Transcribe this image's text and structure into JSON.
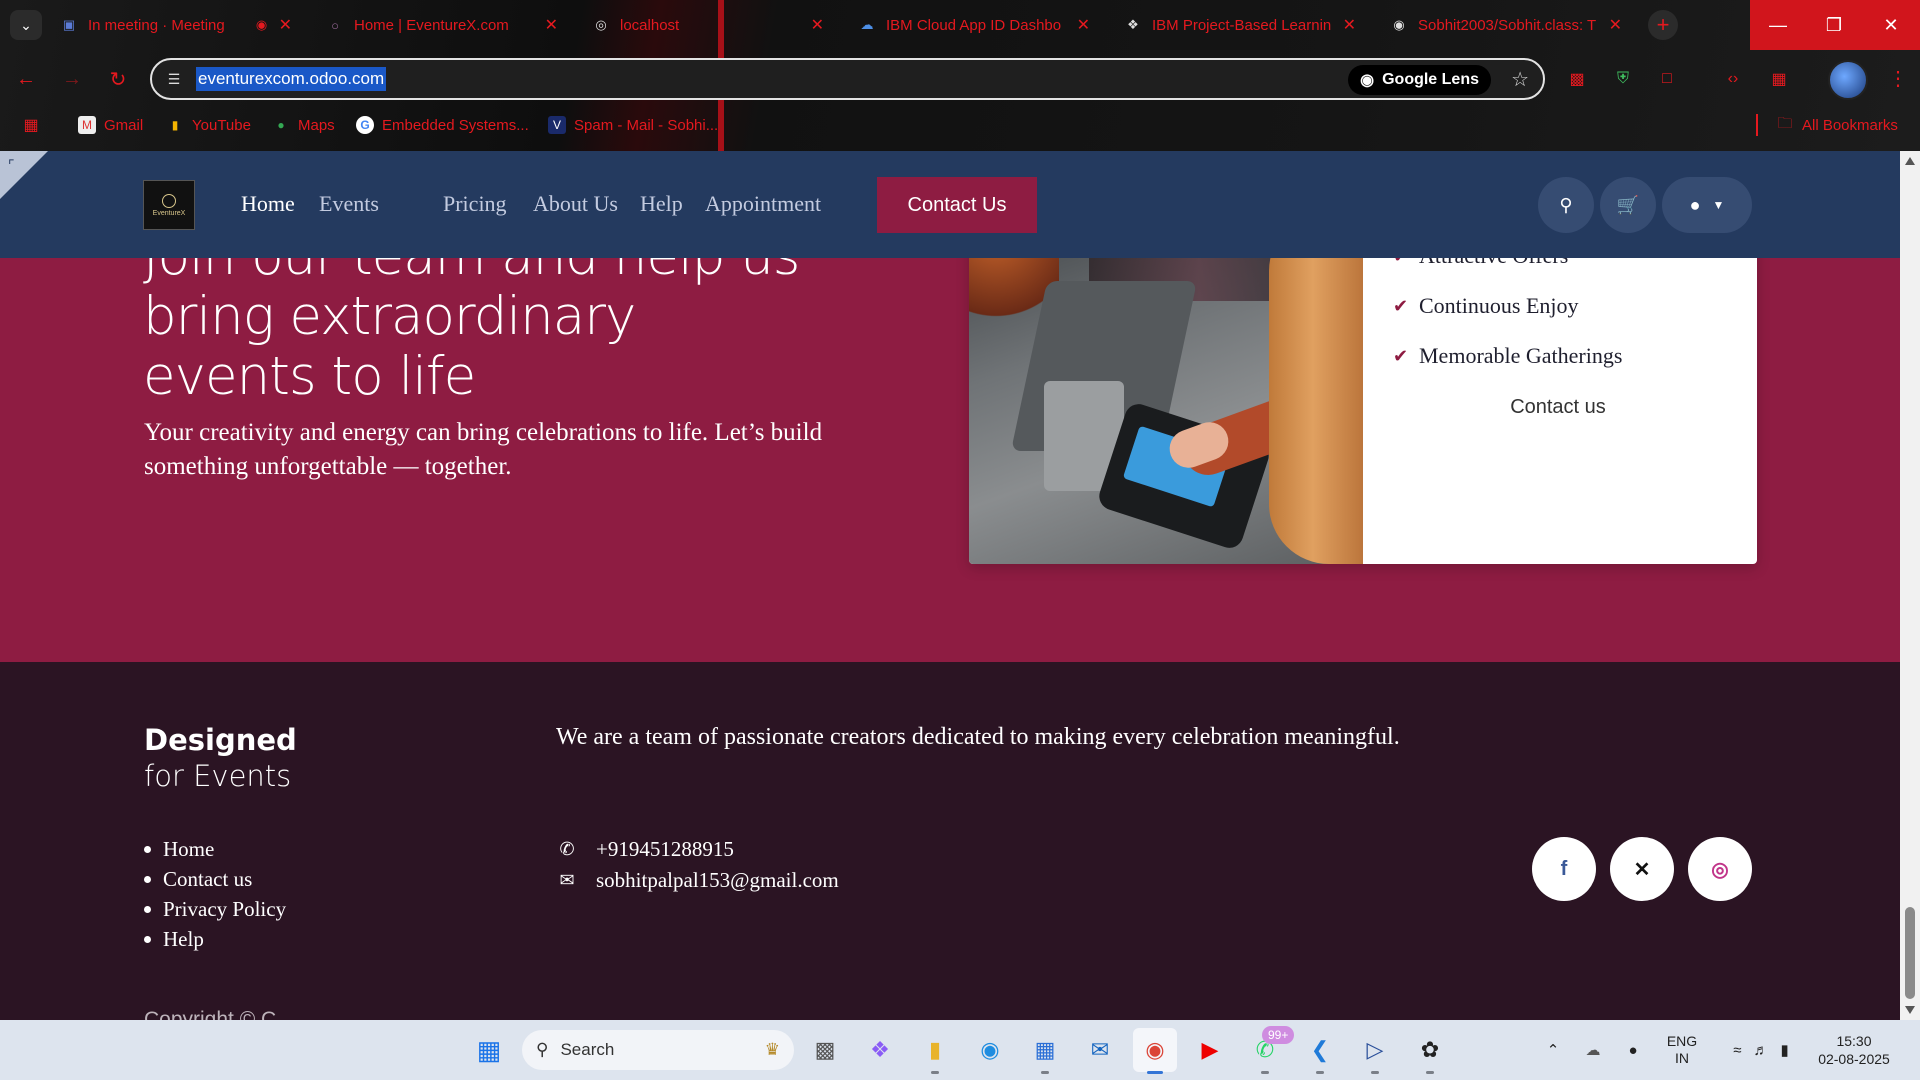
{
  "browser": {
    "tabs": [
      {
        "title": "In meeting · Meeting",
        "icon": "teams-icon",
        "glyph": "▣",
        "active": false
      },
      {
        "title": "Home | EventureX.com",
        "icon": "odoo-icon",
        "glyph": "○",
        "active": false
      },
      {
        "title": "localhost",
        "icon": "globe-icon",
        "glyph": "◎",
        "active": true
      },
      {
        "title": "IBM Cloud App ID Dashbo",
        "icon": "ibm-cloud-icon",
        "glyph": "☁",
        "active": false
      },
      {
        "title": "IBM Project-Based Learnin",
        "icon": "ibm-icon",
        "glyph": "❖",
        "active": false
      },
      {
        "title": "Sobhit2003/Sobhit.class: T",
        "icon": "github-icon",
        "glyph": "◉",
        "active": false
      }
    ],
    "url": "eventurexcom.odoo.com",
    "lens_label": "Google Lens",
    "bookmarks": [
      {
        "label": "Gmail",
        "icon": "gmail-icon"
      },
      {
        "label": "YouTube",
        "icon": "youtube-icon"
      },
      {
        "label": "Maps",
        "icon": "maps-icon"
      },
      {
        "label": "Embedded Systems...",
        "icon": "google-icon"
      },
      {
        "label": "Spam - Mail - Sobhi...",
        "icon": "mail-icon"
      }
    ],
    "all_bookmarks": "All Bookmarks"
  },
  "site": {
    "nav": {
      "links": [
        "Home",
        "Events",
        "Pricing",
        "About Us",
        "Help",
        "Appointment"
      ],
      "active": "Home",
      "contact_button": "Contact Us",
      "logo_text": "EventureX"
    },
    "hero": {
      "title": "Join our team and help us bring extraordinary events to life",
      "subtitle": "Your creativity and energy can bring celebrations to life. Let’s build something unforgettable — together."
    },
    "card": {
      "features": [
        "Attractive Offers",
        "Continuous Enjoy",
        "Memorable Gatherings"
      ],
      "contact_link": "Contact us"
    },
    "footer": {
      "brand_line1": "Designed",
      "brand_line2": "for Events",
      "tagline": "We are a team of passionate creators dedicated to making every celebration meaningful.",
      "links": [
        "Home",
        "Contact us",
        "Privacy Policy",
        "Help"
      ],
      "phone": "+919451288915",
      "email": "sobhitpalpal153@gmail.com",
      "social": [
        {
          "name": "facebook",
          "glyph": "f",
          "color": "#3b5998"
        },
        {
          "name": "x",
          "glyph": "𝕏",
          "color": "#111111"
        },
        {
          "name": "instagram",
          "glyph": "◎",
          "color": "#c1358a"
        }
      ],
      "copyright": "Copyright © C..."
    }
  },
  "taskbar": {
    "search_placeholder": "Search",
    "whatsapp_badge": "99+",
    "language": "ENG",
    "region": "IN",
    "time": "15:30",
    "date": "02-08-2025"
  },
  "colors": {
    "brand_maroon": "#8e1c42",
    "nav_blue": "#243a5f",
    "footer_dark": "#2b1423",
    "chrome_red": "#e5191f"
  }
}
